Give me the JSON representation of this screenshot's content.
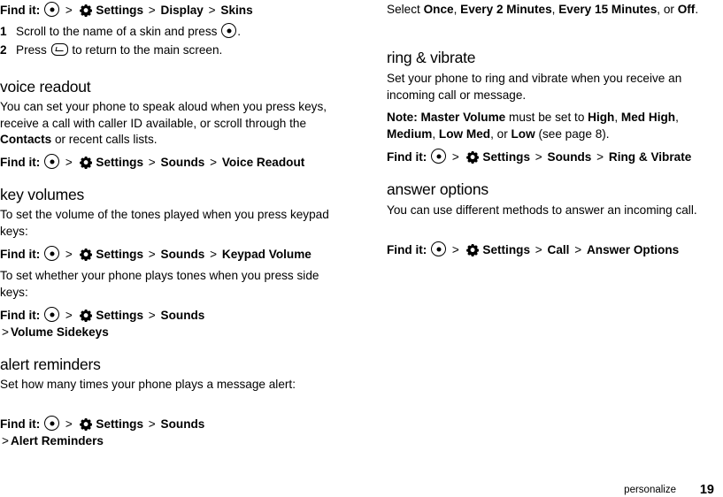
{
  "document": {
    "footer": {
      "chapter": "personalize",
      "page_number": "19"
    }
  },
  "icons": {
    "center_key": "center-select-key-icon",
    "back_key": "back-key-icon",
    "settings": "settings-gear-icon"
  },
  "left_column": {
    "skins_findit": {
      "label": "Find it:",
      "path": [
        "Settings",
        "Display",
        "Skins"
      ]
    },
    "steps": [
      {
        "num": "1",
        "text_before": "Scroll to the name of a skin and press",
        "text_after": "."
      },
      {
        "num": "2",
        "text_before": "Press",
        "text_after": "to return to the main screen."
      }
    ],
    "sections": [
      {
        "heading": "voice readout",
        "paragraphs": [
          "You can set your phone to speak aloud when you press keys, receive a call with caller ID available, or scroll through the Contacts or recent calls lists."
        ],
        "findit": {
          "label": "Find it:",
          "path": [
            "Settings",
            "Sounds",
            "Voice Readout"
          ]
        }
      },
      {
        "heading": "key volumes",
        "paragraphs": [
          "To set the volume of the tones played when you press keypad keys:"
        ],
        "findit": {
          "label": "Find it:",
          "path": [
            "Settings",
            "Sounds",
            "Keypad Volume"
          ]
        },
        "paragraphs2": [
          "To set whether your phone plays tones when you press side keys:"
        ],
        "findit2": {
          "label": "Find it:",
          "path": [
            "Settings",
            "Sounds",
            "Volume Sidekeys"
          ]
        }
      },
      {
        "heading": "alert reminders",
        "paragraphs": [
          "Set how many times your phone plays a message alert:"
        ],
        "findit": {
          "label": "Find it:",
          "path": [
            "Settings",
            "Sounds",
            "Alert Reminders"
          ]
        }
      }
    ]
  },
  "right_column": {
    "intro": {
      "prefix": "Select ",
      "options": [
        "Once",
        "Every 2 Minutes",
        "Every 15 Minutes"
      ],
      "conjunction": ", or ",
      "last_option": "Off",
      "suffix": "."
    },
    "sections": [
      {
        "heading": "ring & vibrate",
        "paragraph": "Set your phone to ring and vibrate when you receive an incoming call or message.",
        "note_label": "Note:",
        "note_parts": {
          "b1": "Master Volume",
          "t1": " must be set to ",
          "b2": "High",
          "t2": ", ",
          "b3": "Med High",
          "t3": ", ",
          "b4": "Medium",
          "t4": ", ",
          "b5": "Low Med",
          "t5": ", or ",
          "b6": "Low",
          "t6": " (see page 8)."
        },
        "findit": {
          "label": "Find it:",
          "path": [
            "Settings",
            "Sounds",
            "Ring & Vibrate"
          ]
        }
      },
      {
        "heading": "answer options",
        "paragraph": "You can use different methods to answer an incoming call.",
        "findit": {
          "label": "Find it:",
          "path": [
            "Settings",
            "Call",
            "Answer Options"
          ]
        }
      }
    ]
  }
}
